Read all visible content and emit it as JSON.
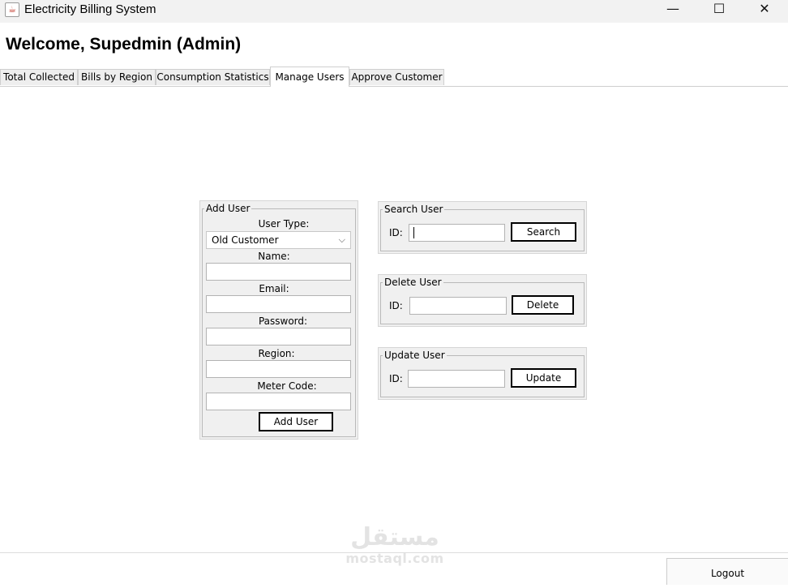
{
  "window": {
    "title": "Electricity Billing System",
    "app_icon": "java-cup-icon",
    "controls": {
      "minimize": "—",
      "maximize": "☐",
      "close": "✕"
    }
  },
  "welcome": "Welcome, Supedmin (Admin)",
  "tabs": [
    {
      "label": "Total Collected",
      "active": false
    },
    {
      "label": "Bills by Region",
      "active": false
    },
    {
      "label": "Consumption Statistics",
      "active": false
    },
    {
      "label": "Manage Users",
      "active": true
    },
    {
      "label": "Approve Customer",
      "active": false
    }
  ],
  "add_user": {
    "legend": "Add User",
    "user_type_label": "User Type:",
    "user_type_value": "Old Customer",
    "name_label": "Name:",
    "email_label": "Email:",
    "password_label": "Password:",
    "region_label": "Region:",
    "meter_code_label": "Meter Code:",
    "button": "Add User"
  },
  "search_user": {
    "legend": "Search User",
    "id_label": "ID:",
    "button": "Search"
  },
  "delete_user": {
    "legend": "Delete User",
    "id_label": "ID:",
    "button": "Delete"
  },
  "update_user": {
    "legend": "Update User",
    "id_label": "ID:",
    "button": "Update"
  },
  "logout": "Logout",
  "watermark": {
    "arabic": "مستقل",
    "latin": "mostaql.com"
  }
}
